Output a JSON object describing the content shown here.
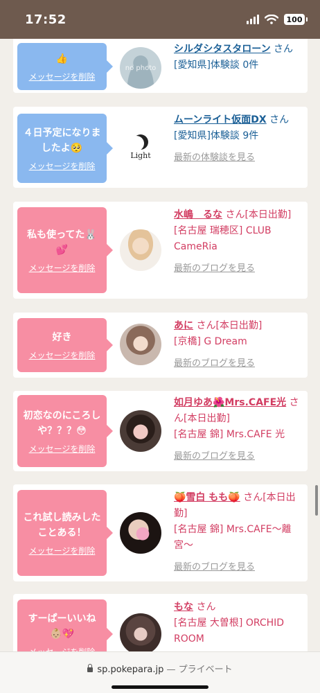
{
  "status": {
    "time": "17:52",
    "battery": "100"
  },
  "cards": [
    {
      "style": "blue",
      "message": "👍",
      "delete": "メッセージを削除",
      "name": "シルダシタスタローン",
      "suffix": " さん",
      "area": "[愛知県]体験談 0件",
      "link": "",
      "avatar": "no-photo-avatar",
      "avatar_text": "no photo"
    },
    {
      "style": "blue",
      "message": "４日予定になりましたよ🥺",
      "delete": "メッセージを削除",
      "name": "ムーンライト仮面DX",
      "suffix": " さん",
      "area": "[愛知県]体験談 9件",
      "link": "最新の体験談を見る",
      "avatar": "light-shop-logo",
      "avatar_text": "Light"
    },
    {
      "style": "pink",
      "message": "私も使ってた🐰💕",
      "delete": "メッセージを削除",
      "name": "水嶋　るな",
      "suffix": " さん[本日出勤]",
      "area": "[名古屋 瑞穂区] CLUB CameRia",
      "link": "最新のブログを見る",
      "avatar": "girl-avatar",
      "avatar_text": ""
    },
    {
      "style": "pink",
      "message": "好き",
      "delete": "メッセージを削除",
      "name": "あに",
      "suffix": " さん[本日出勤]",
      "area": "[京橋] G Dream",
      "link": "最新のブログを見る",
      "avatar": "girl-avatar",
      "avatar_text": ""
    },
    {
      "style": "pink",
      "message": "初恋なのにころしや？？？😳",
      "delete": "メッセージを削除",
      "name": "如月ゆあ🌺Mrs.CAFE光",
      "suffix": " さん[本日出勤]",
      "area": "[名古屋 錦] Mrs.CAFE 光",
      "link": "最新のブログを見る",
      "avatar": "girl-avatar",
      "avatar_text": ""
    },
    {
      "style": "pink",
      "message": "これ試し読みしたことある！",
      "delete": "メッセージを削除",
      "name": "🍑雪白 もも🍑",
      "suffix": " さん[本日出勤]",
      "area": "[名古屋 錦] Mrs.CAFE〜離宮〜",
      "link": "最新のブログを見る",
      "avatar": "girl-avatar",
      "avatar_text": ""
    },
    {
      "style": "pink",
      "message": "すーぱーいいね👶🏼💖",
      "delete": "メッセージを削除",
      "name": "もな",
      "suffix": " さん",
      "area": "[名古屋 大曽根] ORCHID ROOM",
      "link": "",
      "avatar": "girl-avatar",
      "avatar_text": ""
    }
  ],
  "browser": {
    "domain": "sp.pokepara.jp",
    "separator": " — ",
    "mode": "プライベート"
  },
  "colors": {
    "blue_bubble": "#8ab8ef",
    "pink_bubble": "#f78ea3",
    "blue_text": "#1a5f96",
    "pink_text": "#d23d62",
    "status_bar": "#6e5a4e"
  }
}
